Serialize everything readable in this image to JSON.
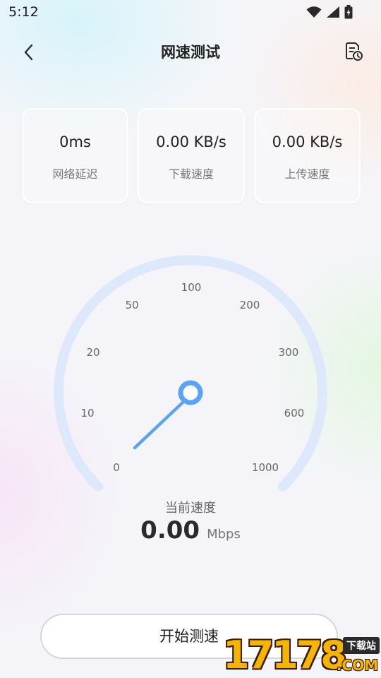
{
  "status_bar": {
    "time": "5:12",
    "icons": [
      "wifi-icon",
      "cellular-signal-icon",
      "battery-icon"
    ]
  },
  "header": {
    "title": "网速测试",
    "back_icon": "chevron-left-icon",
    "history_icon": "history-list-icon"
  },
  "metrics": [
    {
      "value": "0ms",
      "label": "网络延迟"
    },
    {
      "value": "0.00 KB/s",
      "label": "下载速度"
    },
    {
      "value": "0.00 KB/s",
      "label": "上传速度"
    }
  ],
  "gauge": {
    "ticks": [
      "0",
      "10",
      "20",
      "50",
      "100",
      "200",
      "300",
      "600",
      "1000"
    ],
    "current_value_mbps": 0,
    "track_color": "#dde8fb",
    "needle_color": "#5aa3f5"
  },
  "current": {
    "label": "当前速度",
    "value": "0.00",
    "unit": "Mbps"
  },
  "start_button": {
    "label": "开始测速"
  },
  "watermark": {
    "digits": "17178",
    "badge": "下载站",
    "domain": ".COM"
  }
}
